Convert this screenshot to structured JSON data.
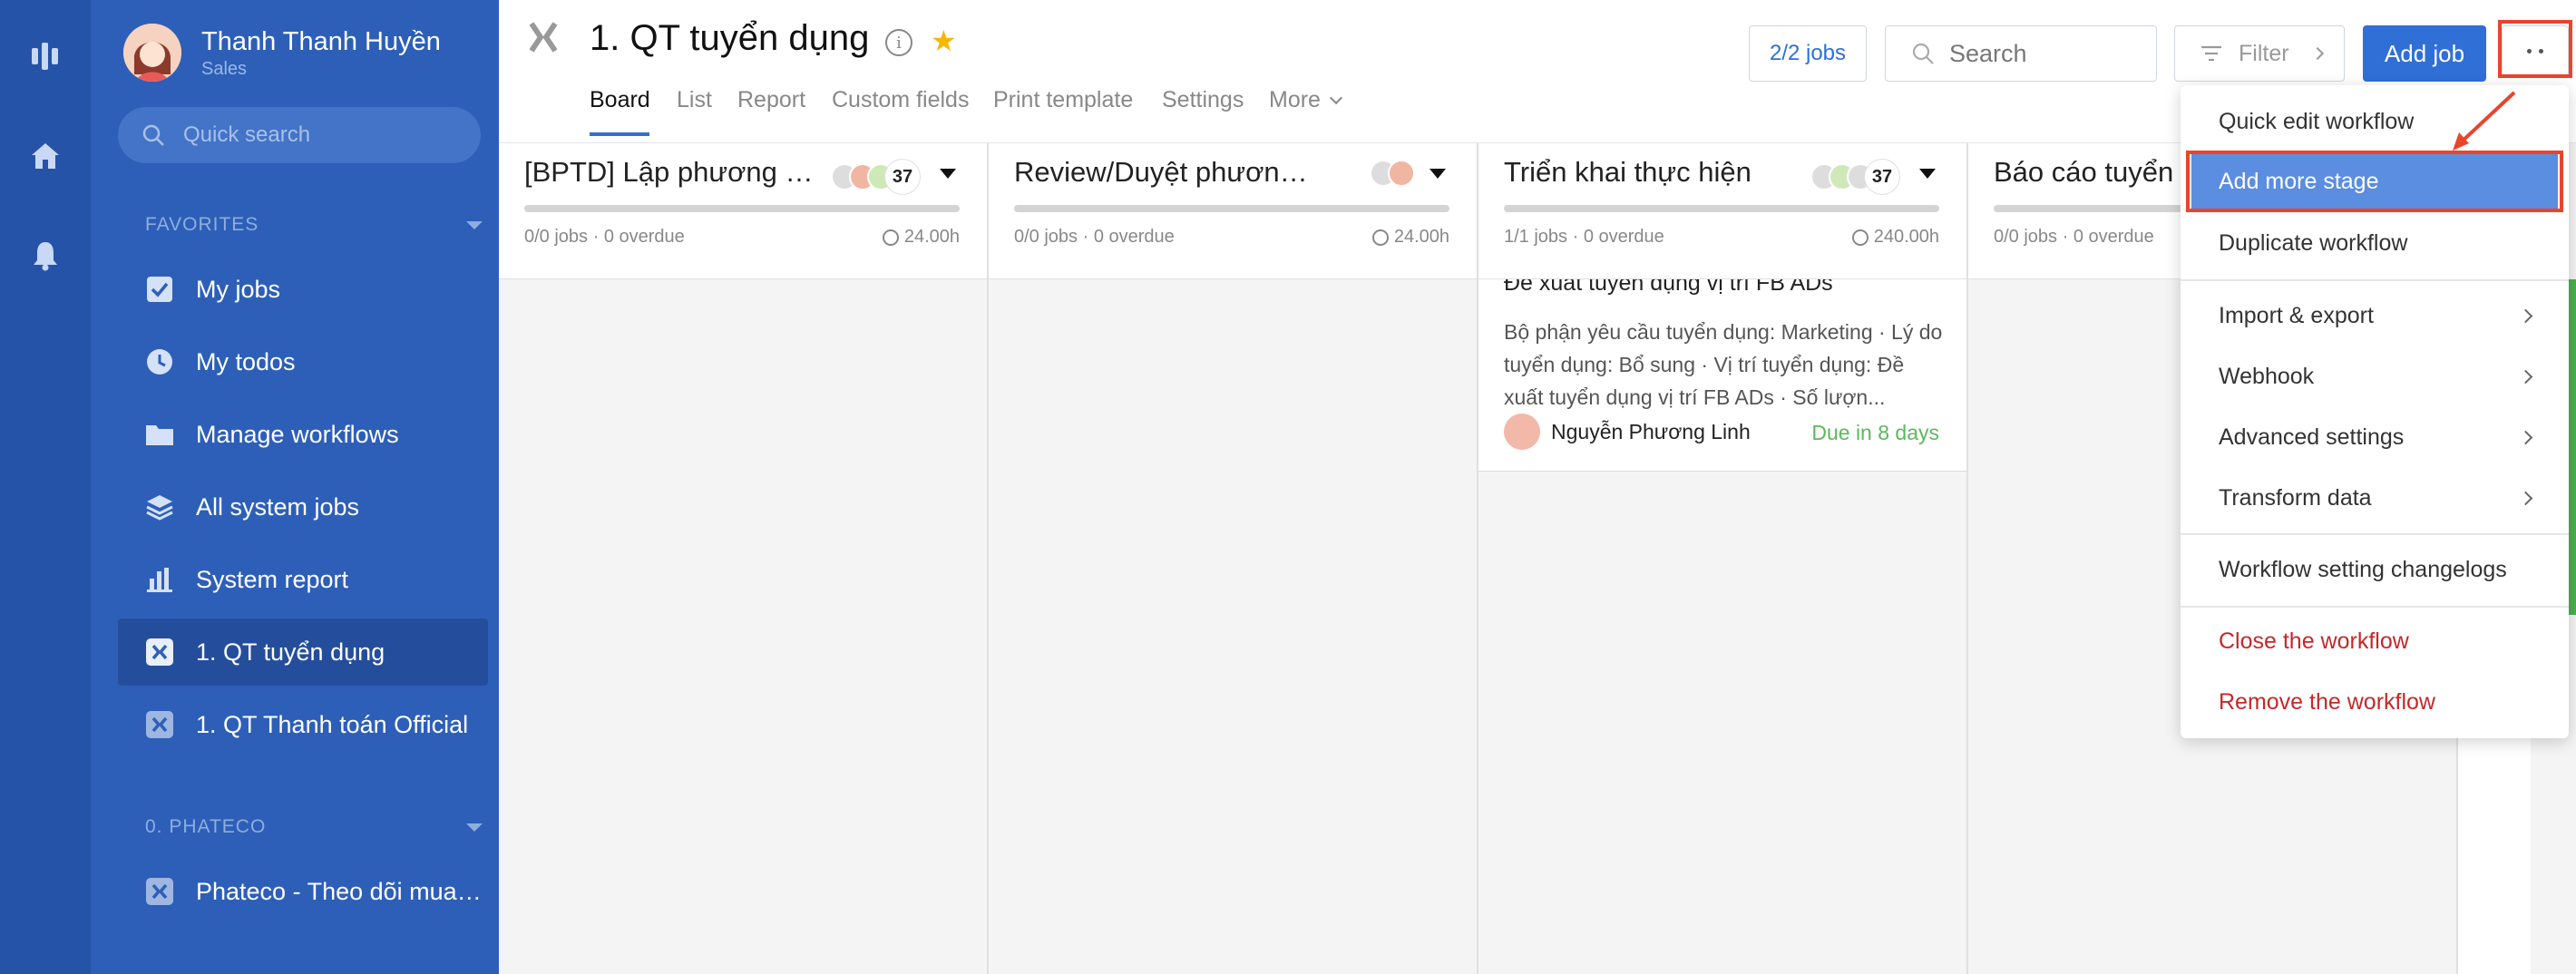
{
  "profile": {
    "name": "Thanh Thanh Huyền",
    "role": "Sales"
  },
  "sidebar": {
    "quick_search_placeholder": "Quick search",
    "favorites_label": "FAVORITES",
    "items": [
      {
        "label": "My jobs"
      },
      {
        "label": "My todos"
      },
      {
        "label": "Manage workflows"
      },
      {
        "label": "All system jobs"
      },
      {
        "label": "System report"
      },
      {
        "label": "1. QT tuyển dụng"
      },
      {
        "label": "1. QT Thanh toán Official"
      }
    ],
    "group2_label": "0. PHATECO",
    "group2_items": [
      {
        "label": "Phateco - Theo dõi mua hàng"
      }
    ]
  },
  "header": {
    "title": "1. QT tuyển dụng",
    "info_glyph": "i",
    "star_glyph": "★",
    "tabs": [
      "Board",
      "List",
      "Report",
      "Custom fields",
      "Print template",
      "Settings",
      "More"
    ],
    "jobs_pill": "2/2 jobs",
    "search_placeholder": "Search",
    "filter_label": "Filter",
    "add_job_label": "Add job"
  },
  "board": {
    "columns": [
      {
        "title": "[BPTD] Lập phương án tuyển dụng",
        "count": "37",
        "stats": "0/0 jobs · 0 overdue",
        "hours": "24.00h"
      },
      {
        "title": "Review/Duyệt phương án",
        "count": "",
        "stats": "0/0 jobs · 0 overdue",
        "hours": "24.00h"
      },
      {
        "title": "Triển khai thực hiện",
        "count": "37",
        "stats": "1/1 jobs · 0 overdue",
        "hours": "240.00h"
      },
      {
        "title": "Báo cáo tuyển dụng",
        "count": "",
        "stats": "0/0 jobs · 0 overdue",
        "hours": ""
      }
    ],
    "card": {
      "title": "Đề xuất tuyển dụng vị trí FB ADs",
      "description": "Bộ phận yêu cầu tuyển dụng: Marketing · Lý do tuyển dụng: Bổ sung · Vị trí tuyển dụng: Đề xuất tuyển dụng vị trí FB ADs · Số lượn...",
      "assignee": "Nguyễn Phương Linh",
      "due": "Due in 8 days"
    }
  },
  "menu": {
    "items": [
      "Quick edit workflow",
      "Add more stage",
      "Duplicate workflow",
      "Import & export",
      "Webhook",
      "Advanced settings",
      "Transform data",
      "Workflow setting changelogs",
      "Close the workflow",
      "Remove the workflow"
    ]
  },
  "colors": {
    "sidebar": "#2d5fb8",
    "rail": "#2553a8",
    "accent": "#2f6fd6",
    "highlight_box": "#e8452c",
    "menu_highlight": "#5b8de0",
    "danger": "#c62828",
    "due": "#5cb85c"
  },
  "icons": [
    "logo-icon",
    "home-icon",
    "bell-icon",
    "search-icon",
    "check-square-icon",
    "clock-icon",
    "folder-icon",
    "layers-icon",
    "bar-chart-icon",
    "workflow-x-icon",
    "info-icon",
    "star-icon",
    "filter-icon",
    "chevron-right-icon",
    "more-dots-icon",
    "caret-down-icon",
    "clock-small-icon"
  ]
}
